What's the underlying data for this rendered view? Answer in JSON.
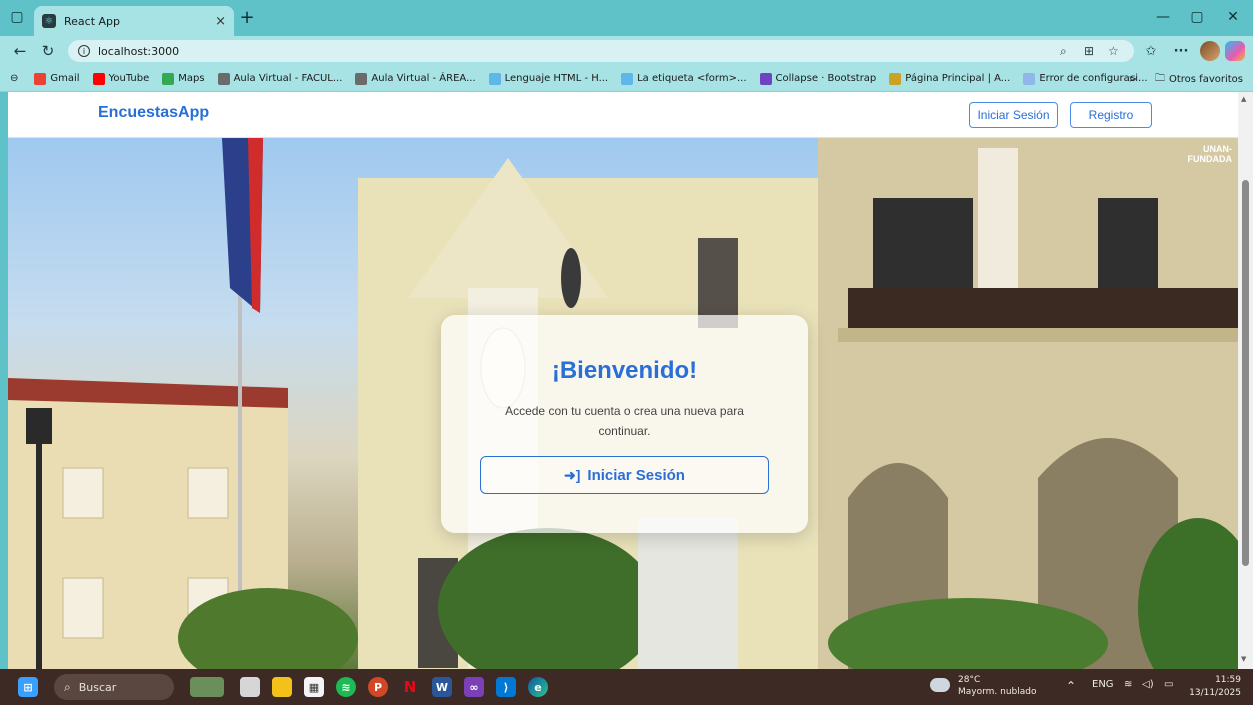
{
  "browser": {
    "tab_title": "React App",
    "tab_close": "×",
    "new_tab": "+",
    "url": "localhost:3000",
    "more": "···"
  },
  "bookmarks": [
    {
      "label": "Gmail",
      "color": "#ea4335",
      "icon": "gmail-icon"
    },
    {
      "label": "YouTube",
      "color": "#ff0000",
      "icon": "youtube-icon"
    },
    {
      "label": "Maps",
      "color": "#34a853",
      "icon": "maps-icon"
    },
    {
      "label": "Aula Virtual - FACUL...",
      "color": "#6b6b6b",
      "icon": "aula-icon"
    },
    {
      "label": "Aula Virtual - ÁREA...",
      "color": "#6b6b6b",
      "icon": "aula-icon"
    },
    {
      "label": "Lenguaje HTML - H...",
      "color": "#5fb6e8",
      "icon": "html-icon"
    },
    {
      "label": "La etiqueta <form>...",
      "color": "#5fb6e8",
      "icon": "form-icon"
    },
    {
      "label": "Collapse · Bootstrap",
      "color": "#6f42c1",
      "icon": "bootstrap-icon"
    },
    {
      "label": "Página Principal | A...",
      "color": "#c9a227",
      "icon": "page-icon"
    },
    {
      "label": "Error de configuraci...",
      "color": "#8fb8e8",
      "icon": "globe-icon"
    }
  ],
  "bookmarks_more": ">",
  "bookmarks_other": "Otros favoritos",
  "app": {
    "brand": "EncuestasApp",
    "login_label": "Iniciar Sesión",
    "register_label": "Registro"
  },
  "welcome": {
    "title": "¡Bienvenido!",
    "text": "Accede con tu cuenta o crea una nueva para continuar.",
    "cta_label": "Iniciar Sesión"
  },
  "hero_badge": {
    "line1": "UNAN-",
    "line2": "FUNDADA"
  },
  "taskbar": {
    "search_placeholder": "Buscar",
    "weather_temp": "28°C",
    "weather_desc": "Mayorm. nublado",
    "lang": "ENG",
    "time": "11:59",
    "date": "13/11/2025"
  },
  "colors": {
    "accent": "#2a6fd6",
    "browser_frame": "#5fc2c9",
    "taskbar": "#3d2a24"
  }
}
